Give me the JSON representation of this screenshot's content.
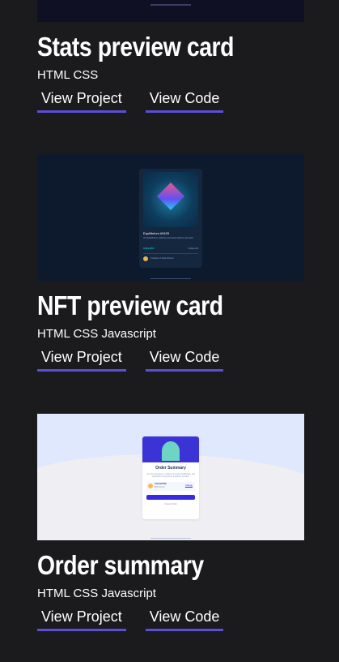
{
  "projects": [
    {
      "title": "Stats preview card",
      "tech": "HTML CSS",
      "view_project": "View Project",
      "view_code": "View Code"
    },
    {
      "title": "NFT preview card",
      "tech": "HTML CSS Javascript",
      "view_project": "View Project",
      "view_code": "View Code",
      "preview": {
        "nft_name": "Equilibrium #3429",
        "nft_desc": "Our Equilibrium collection promotes balance and calm.",
        "price": "0.041 ETH",
        "days": "3 days left",
        "creator": "Creation of Jules Wyvern"
      }
    },
    {
      "title": "Order summary",
      "tech": "HTML CSS Javascript",
      "view_project": "View Project",
      "view_code": "View Code",
      "preview": {
        "heading": "Order Summary",
        "text": "You can now listen to millions of songs, audiobooks, and podcasts on any device anywhere you like!",
        "plan": "Annual Plan",
        "plan_price": "$59.99/year",
        "change": "Change",
        "proceed": "Proceed to Payment",
        "cancel": "Cancel Order"
      }
    }
  ]
}
